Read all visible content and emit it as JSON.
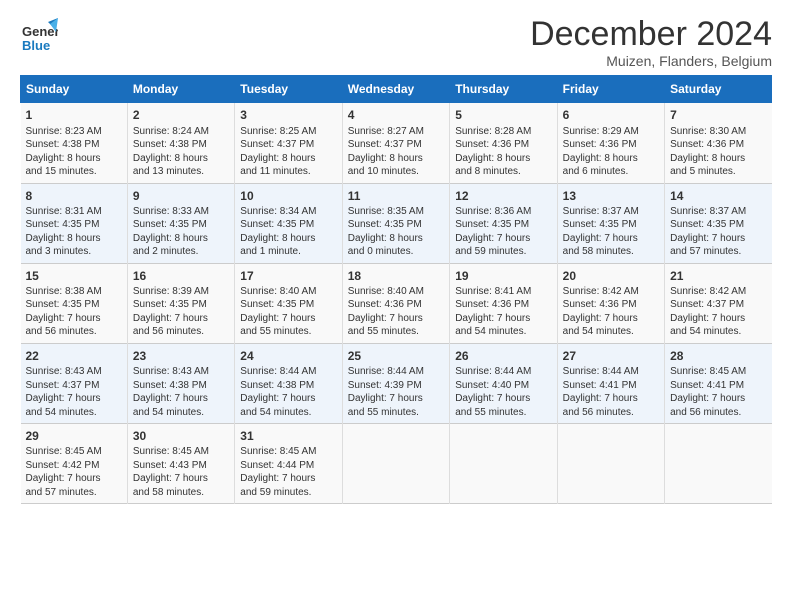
{
  "logo": {
    "line1": "General",
    "line2": "Blue"
  },
  "title": "December 2024",
  "subtitle": "Muizen, Flanders, Belgium",
  "headers": [
    "Sunday",
    "Monday",
    "Tuesday",
    "Wednesday",
    "Thursday",
    "Friday",
    "Saturday"
  ],
  "weeks": [
    [
      {
        "day": "1",
        "info": "Sunrise: 8:23 AM\nSunset: 4:38 PM\nDaylight: 8 hours\nand 15 minutes."
      },
      {
        "day": "2",
        "info": "Sunrise: 8:24 AM\nSunset: 4:38 PM\nDaylight: 8 hours\nand 13 minutes."
      },
      {
        "day": "3",
        "info": "Sunrise: 8:25 AM\nSunset: 4:37 PM\nDaylight: 8 hours\nand 11 minutes."
      },
      {
        "day": "4",
        "info": "Sunrise: 8:27 AM\nSunset: 4:37 PM\nDaylight: 8 hours\nand 10 minutes."
      },
      {
        "day": "5",
        "info": "Sunrise: 8:28 AM\nSunset: 4:36 PM\nDaylight: 8 hours\nand 8 minutes."
      },
      {
        "day": "6",
        "info": "Sunrise: 8:29 AM\nSunset: 4:36 PM\nDaylight: 8 hours\nand 6 minutes."
      },
      {
        "day": "7",
        "info": "Sunrise: 8:30 AM\nSunset: 4:36 PM\nDaylight: 8 hours\nand 5 minutes."
      }
    ],
    [
      {
        "day": "8",
        "info": "Sunrise: 8:31 AM\nSunset: 4:35 PM\nDaylight: 8 hours\nand 3 minutes."
      },
      {
        "day": "9",
        "info": "Sunrise: 8:33 AM\nSunset: 4:35 PM\nDaylight: 8 hours\nand 2 minutes."
      },
      {
        "day": "10",
        "info": "Sunrise: 8:34 AM\nSunset: 4:35 PM\nDaylight: 8 hours\nand 1 minute."
      },
      {
        "day": "11",
        "info": "Sunrise: 8:35 AM\nSunset: 4:35 PM\nDaylight: 8 hours\nand 0 minutes."
      },
      {
        "day": "12",
        "info": "Sunrise: 8:36 AM\nSunset: 4:35 PM\nDaylight: 7 hours\nand 59 minutes."
      },
      {
        "day": "13",
        "info": "Sunrise: 8:37 AM\nSunset: 4:35 PM\nDaylight: 7 hours\nand 58 minutes."
      },
      {
        "day": "14",
        "info": "Sunrise: 8:37 AM\nSunset: 4:35 PM\nDaylight: 7 hours\nand 57 minutes."
      }
    ],
    [
      {
        "day": "15",
        "info": "Sunrise: 8:38 AM\nSunset: 4:35 PM\nDaylight: 7 hours\nand 56 minutes."
      },
      {
        "day": "16",
        "info": "Sunrise: 8:39 AM\nSunset: 4:35 PM\nDaylight: 7 hours\nand 56 minutes."
      },
      {
        "day": "17",
        "info": "Sunrise: 8:40 AM\nSunset: 4:35 PM\nDaylight: 7 hours\nand 55 minutes."
      },
      {
        "day": "18",
        "info": "Sunrise: 8:40 AM\nSunset: 4:36 PM\nDaylight: 7 hours\nand 55 minutes."
      },
      {
        "day": "19",
        "info": "Sunrise: 8:41 AM\nSunset: 4:36 PM\nDaylight: 7 hours\nand 54 minutes."
      },
      {
        "day": "20",
        "info": "Sunrise: 8:42 AM\nSunset: 4:36 PM\nDaylight: 7 hours\nand 54 minutes."
      },
      {
        "day": "21",
        "info": "Sunrise: 8:42 AM\nSunset: 4:37 PM\nDaylight: 7 hours\nand 54 minutes."
      }
    ],
    [
      {
        "day": "22",
        "info": "Sunrise: 8:43 AM\nSunset: 4:37 PM\nDaylight: 7 hours\nand 54 minutes."
      },
      {
        "day": "23",
        "info": "Sunrise: 8:43 AM\nSunset: 4:38 PM\nDaylight: 7 hours\nand 54 minutes."
      },
      {
        "day": "24",
        "info": "Sunrise: 8:44 AM\nSunset: 4:38 PM\nDaylight: 7 hours\nand 54 minutes."
      },
      {
        "day": "25",
        "info": "Sunrise: 8:44 AM\nSunset: 4:39 PM\nDaylight: 7 hours\nand 55 minutes."
      },
      {
        "day": "26",
        "info": "Sunrise: 8:44 AM\nSunset: 4:40 PM\nDaylight: 7 hours\nand 55 minutes."
      },
      {
        "day": "27",
        "info": "Sunrise: 8:44 AM\nSunset: 4:41 PM\nDaylight: 7 hours\nand 56 minutes."
      },
      {
        "day": "28",
        "info": "Sunrise: 8:45 AM\nSunset: 4:41 PM\nDaylight: 7 hours\nand 56 minutes."
      }
    ],
    [
      {
        "day": "29",
        "info": "Sunrise: 8:45 AM\nSunset: 4:42 PM\nDaylight: 7 hours\nand 57 minutes."
      },
      {
        "day": "30",
        "info": "Sunrise: 8:45 AM\nSunset: 4:43 PM\nDaylight: 7 hours\nand 58 minutes."
      },
      {
        "day": "31",
        "info": "Sunrise: 8:45 AM\nSunset: 4:44 PM\nDaylight: 7 hours\nand 59 minutes."
      },
      {
        "day": "",
        "info": ""
      },
      {
        "day": "",
        "info": ""
      },
      {
        "day": "",
        "info": ""
      },
      {
        "day": "",
        "info": ""
      }
    ]
  ]
}
